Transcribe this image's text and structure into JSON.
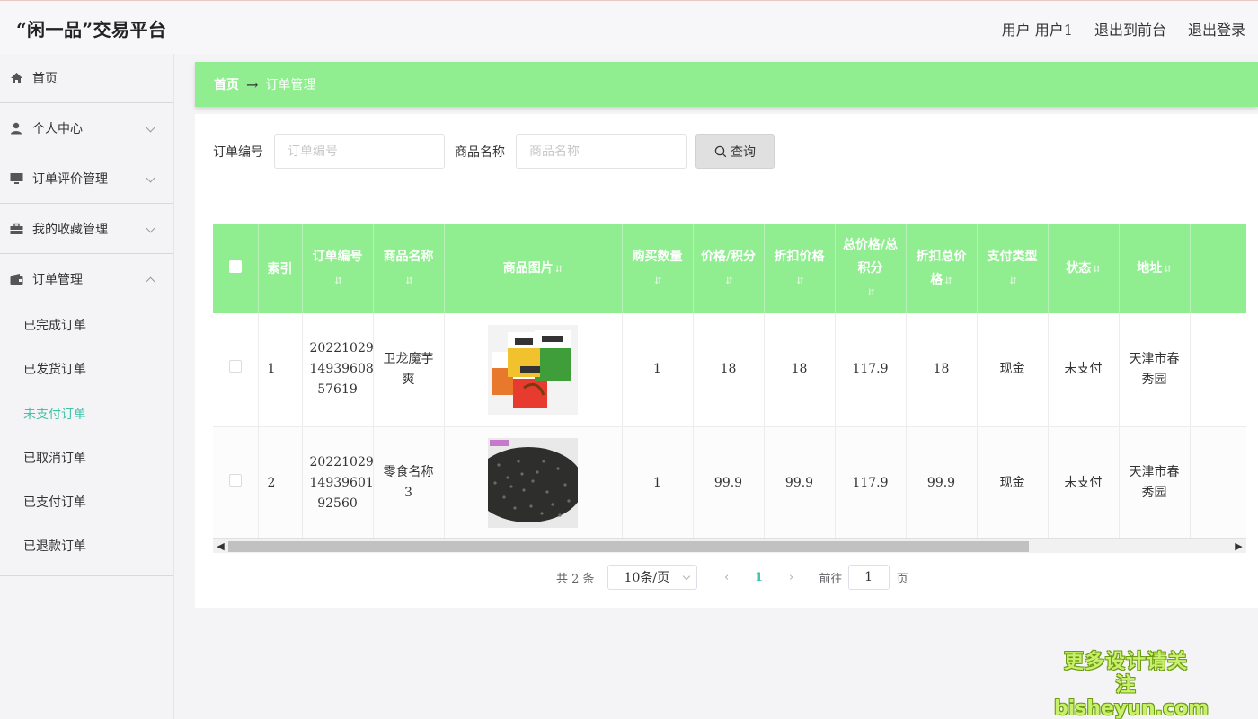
{
  "app": {
    "title": "“闲一品”交易平台",
    "user_label": "用户 用户1",
    "to_frontend": "退出到前台",
    "logout": "退出登录"
  },
  "sidebar": {
    "items": [
      {
        "label": "首页",
        "icon": "home-icon"
      },
      {
        "label": "个人中心",
        "icon": "user-icon",
        "expanded": false
      },
      {
        "label": "订单评价管理",
        "icon": "monitor-icon",
        "expanded": false
      },
      {
        "label": "我的收藏管理",
        "icon": "briefcase-icon",
        "expanded": false
      },
      {
        "label": "订单管理",
        "icon": "wallet-icon",
        "expanded": true
      }
    ],
    "order_sub": [
      {
        "label": "已完成订单",
        "active": false
      },
      {
        "label": "已发货订单",
        "active": false
      },
      {
        "label": "未支付订单",
        "active": true
      },
      {
        "label": "已取消订单",
        "active": false
      },
      {
        "label": "已支付订单",
        "active": false
      },
      {
        "label": "已退款订单",
        "active": false
      }
    ]
  },
  "breadcrumb": {
    "home": "首页",
    "arrow": "→",
    "current": "订单管理"
  },
  "search": {
    "order_no_label": "订单编号",
    "order_no_placeholder": "订单编号",
    "product_name_label": "商品名称",
    "product_name_placeholder": "商品名称",
    "query_button": "查询"
  },
  "table": {
    "columns": [
      "索引",
      "订单编号",
      "商品名称",
      "商品图片",
      "购买数量",
      "价格/积分",
      "折扣价格",
      "总价格/总积分",
      "折扣总价格",
      "支付类型",
      "状态",
      "地址"
    ],
    "rows": [
      {
        "index": "1",
        "order_no": "2022102914939608 57619",
        "order_no_lines": [
          "20221029",
          "14939608",
          "57619"
        ],
        "product_name": "卫龙魔芋爽",
        "quantity": "1",
        "price": "18",
        "discount_price": "18",
        "total_price": "117.9",
        "discount_total": "18",
        "pay_type": "现金",
        "status": "未支付",
        "address": "天津市春秀园"
      },
      {
        "index": "2",
        "order_no": "2022102914939601 92560",
        "order_no_lines": [
          "20221029",
          "14939601",
          "92560"
        ],
        "product_name": "零食名称3",
        "quantity": "1",
        "price": "99.9",
        "discount_price": "99.9",
        "total_price": "117.9",
        "discount_total": "99.9",
        "pay_type": "现金",
        "status": "未支付",
        "address": "天津市春秀园"
      }
    ]
  },
  "pagination": {
    "total": "共 2 条",
    "page_size": "10条/页",
    "current_page": "1",
    "goto_label": "前往",
    "goto_value": "1",
    "page_unit": "页"
  },
  "watermark": {
    "line1": "更多设计请关注",
    "line2": "bisheyun.com"
  },
  "colors": {
    "accent_green": "#90ee90",
    "active_teal": "#40c4a8"
  }
}
